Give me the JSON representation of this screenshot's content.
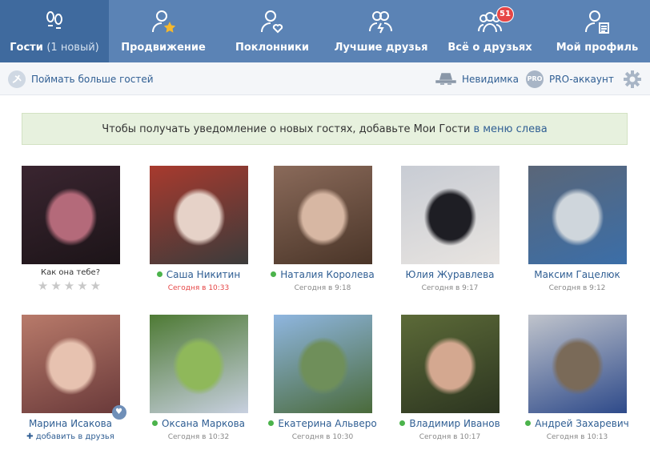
{
  "nav": {
    "tabs": [
      {
        "label": "Гости",
        "sub": "(1 новый)",
        "icon": "footprints-icon"
      },
      {
        "label": "Продвижение",
        "icon": "user-star-icon"
      },
      {
        "label": "Поклонники",
        "icon": "user-heart-icon"
      },
      {
        "label": "Лучшие друзья",
        "icon": "users-bolt-icon"
      },
      {
        "label": "Всё о друзьях",
        "icon": "users-group-icon",
        "badge": "51"
      },
      {
        "label": "Мой профиль",
        "icon": "user-card-icon"
      }
    ]
  },
  "toolbar": {
    "more_guests": "Поймать больше гостей",
    "invisible": "Невидимка",
    "pro_badge": "PRO",
    "pro": "PRO-аккаунт"
  },
  "notice": {
    "text": "Чтобы получать уведомление о новых гостях, добавьте Мои Гости",
    "link": "в меню слева"
  },
  "guests": [
    {
      "name": "",
      "time": "",
      "rate_question": "Как она тебе?",
      "online": false,
      "colors": [
        "#3a2530",
        "#b46a7a",
        "#1c1418"
      ]
    },
    {
      "name": "Саша Никитин",
      "time": "Сегодня в 10:33",
      "online": true,
      "new": true,
      "colors": [
        "#a83a2e",
        "#e6d2c8",
        "#3b3b3b"
      ]
    },
    {
      "name": "Наталия Королева",
      "time": "Сегодня в 9:18",
      "online": true,
      "colors": [
        "#8a6a5a",
        "#d7b7a3",
        "#4a3528"
      ]
    },
    {
      "name": "Юлия Журавлева",
      "time": "Сегодня в 9:17",
      "online": false,
      "colors": [
        "#c8ccd4",
        "#1e1e24",
        "#e8e4e0"
      ]
    },
    {
      "name": "Максим Гацелюк",
      "time": "Сегодня в 9:12",
      "online": false,
      "colors": [
        "#5a6678",
        "#cfd6dc",
        "#3b6ea8"
      ]
    },
    {
      "name": "Марина Исакова",
      "time": "",
      "add_label": "добавить в друзья",
      "online": false,
      "colors": [
        "#b87a6a",
        "#e7c2b0",
        "#6a3a3a"
      ]
    },
    {
      "name": "Оксана Маркова",
      "time": "Сегодня в 10:32",
      "online": true,
      "colors": [
        "#4e7a34",
        "#8fb85a",
        "#c8d0e0"
      ]
    },
    {
      "name": "Екатерина Альверо",
      "time": "Сегодня в 10:30",
      "online": true,
      "colors": [
        "#8fb6e0",
        "#6f8f5a",
        "#4a6a3a"
      ]
    },
    {
      "name": "Владимир Иванов",
      "time": "Сегодня в 10:17",
      "online": true,
      "colors": [
        "#5c6a38",
        "#d4a890",
        "#2c3520"
      ]
    },
    {
      "name": "Андрей Захаревич",
      "time": "Сегодня в 10:13",
      "online": true,
      "colors": [
        "#c0c4cc",
        "#7a6a58",
        "#2e4a8a"
      ]
    }
  ]
}
